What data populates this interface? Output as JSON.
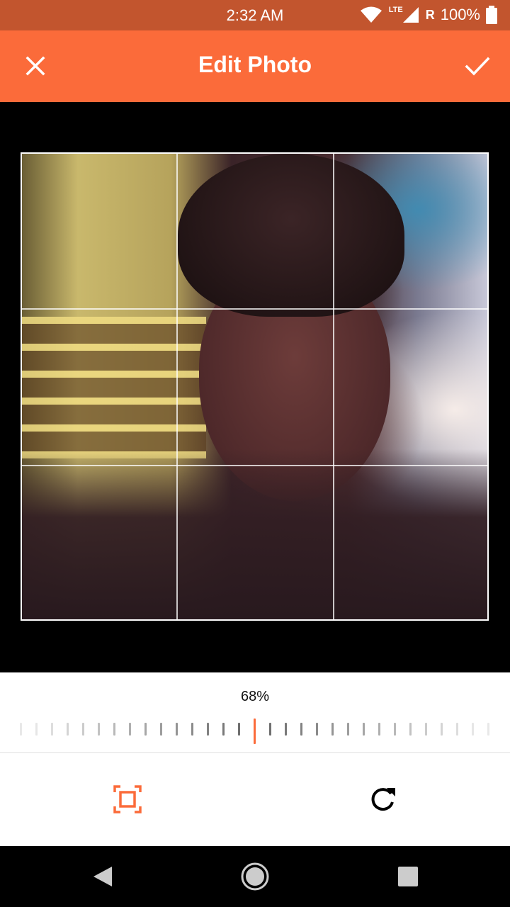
{
  "status_bar": {
    "time": "2:32 AM",
    "network": "LTE",
    "roaming": "R",
    "battery": "100%"
  },
  "toolbar": {
    "title": "Edit Photo",
    "close_icon": "close-icon",
    "done_icon": "check-icon"
  },
  "editor": {
    "zoom_value": "68%",
    "zoom_level": 0.68
  },
  "tools": {
    "crop_icon": "crop-frame-icon",
    "rotate_icon": "rotate-icon"
  },
  "nav": {
    "back_icon": "back-triangle-icon",
    "home_icon": "home-circle-icon",
    "recents_icon": "recents-square-icon"
  },
  "colors": {
    "accent": "#fb6b3a",
    "status_bar": "#c2552e"
  }
}
